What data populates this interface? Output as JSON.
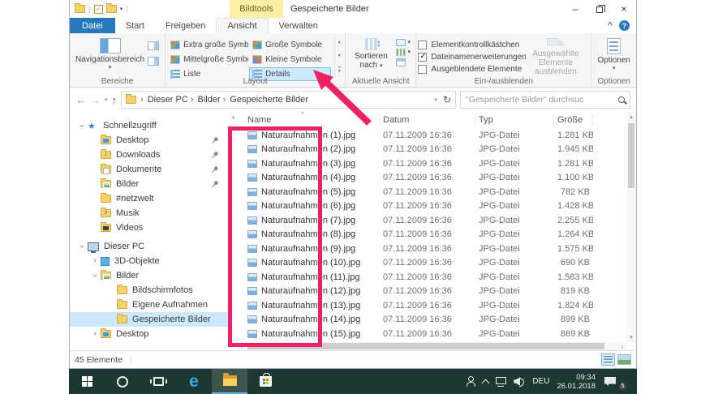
{
  "icons": {
    "minimize": "–",
    "close": "×",
    "dropdown": "▾",
    "help": "?",
    "collapse_ribbon": "^",
    "back": "←",
    "forward": "→",
    "up": "↑",
    "refresh": "↻",
    "crumb_sep": "›",
    "sort_asc": "^",
    "updown": "↕",
    "up_small": "▴",
    "down_small": "▾",
    "left_small": "‹",
    "right_small": "›",
    "separator": "|"
  },
  "window": {
    "title": "Gespeicherte Bilder",
    "contextual_tab": "Bildtools"
  },
  "tabs": [
    {
      "label": "Datei",
      "state": "file"
    },
    {
      "label": "Start",
      "state": ""
    },
    {
      "label": "Freigeben",
      "state": ""
    },
    {
      "label": "Ansicht",
      "state": "active"
    },
    {
      "label": "Verwalten",
      "state": ""
    }
  ],
  "ribbon": {
    "bereiche": {
      "label": "Bereiche",
      "nav_button": "Navigationsbereich"
    },
    "layout": {
      "label": "Layout",
      "options": [
        {
          "label": "Extra große Symbole",
          "icon": "ico-tiles",
          "state": ""
        },
        {
          "label": "Mittelgroße Symbole",
          "icon": "ico-tiles",
          "state": ""
        },
        {
          "label": "Liste",
          "icon": "ico-list",
          "state": ""
        },
        {
          "label": "Große Symbole",
          "icon": "ico-tiles",
          "state": ""
        },
        {
          "label": "Kleine Symbole",
          "icon": "ico-tiles2",
          "state": ""
        },
        {
          "label": "Details",
          "icon": "ico-list",
          "state": "selected"
        }
      ]
    },
    "aktuelle_ansicht": {
      "label": "Aktuelle Ansicht",
      "sort_label": "Sortieren nach"
    },
    "ein_ausblenden": {
      "label": "Ein-/ausblenden",
      "checkboxes": [
        {
          "label": "Elementkontrollkästchen",
          "state": ""
        },
        {
          "label": "Dateinamenerweiterungen",
          "state": "checked"
        },
        {
          "label": "Ausgeblendete Elemente",
          "state": ""
        }
      ],
      "hide_button": "Ausgewählte Elemente ausblenden"
    },
    "optionen": {
      "label": "Optionen"
    }
  },
  "address": {
    "crumbs": [
      {
        "t": "Dieser PC"
      },
      {
        "t": "Bilder"
      },
      {
        "t": "Gespeicherte Bilder"
      }
    ],
    "search_placeholder": "\"Gespeicherte Bilder\" durchsuc"
  },
  "sidebar": {
    "items": [
      {
        "label": "Schnellzugriff",
        "icon": "ic-star",
        "chev": "d",
        "state": "lvl0"
      },
      {
        "label": "Desktop",
        "icon": "ic-f ic-f-desktop",
        "chev": "",
        "state": "lvl1 pinned"
      },
      {
        "label": "Downloads",
        "icon": "ic-f ic-f-down",
        "chev": "",
        "state": "lvl1 pinned"
      },
      {
        "label": "Dokumente",
        "icon": "ic-f ic-f-doc",
        "chev": "",
        "state": "lvl1 pinned"
      },
      {
        "label": "Bilder",
        "icon": "ic-f ic-f-pic",
        "chev": "",
        "state": "lvl1 pinned"
      },
      {
        "label": "#netzwelt",
        "icon": "ic-f",
        "chev": "",
        "state": "lvl1"
      },
      {
        "label": "Musik",
        "icon": "ic-f ic-f-music",
        "chev": "",
        "state": "lvl1"
      },
      {
        "label": "Videos",
        "icon": "ic-f ic-f-video",
        "chev": "",
        "state": "lvl1"
      },
      {
        "label": "Dieser PC",
        "icon": "ic-pc",
        "chev": "d",
        "state": "lvl0 gap"
      },
      {
        "label": "3D-Objekte",
        "icon": "ic-3d",
        "chev": "r",
        "state": "lvl1c"
      },
      {
        "label": "Bilder",
        "icon": "ic-f ic-f-pic",
        "chev": "d",
        "state": "lvl1c"
      },
      {
        "label": "Bildschirmfotos",
        "icon": "ic-f",
        "chev": "",
        "state": "lvl2"
      },
      {
        "label": "Eigene Aufnahmen",
        "icon": "ic-f",
        "chev": "",
        "state": "lvl2"
      },
      {
        "label": "Gespeicherte Bilder",
        "icon": "ic-f",
        "chev": "",
        "state": "lvl2 selected"
      },
      {
        "label": "Desktop",
        "icon": "ic-f ic-f-desktop",
        "chev": "r",
        "state": "lvl1c"
      }
    ]
  },
  "file_list": {
    "columns": {
      "name": "Name",
      "date": "Datum",
      "type": "Typ",
      "size": "Größe"
    },
    "files": [
      {
        "name": "Naturaufnahmen (1).jpg",
        "date": "07.11.2009 16:36",
        "type": "JPG-Datei",
        "size": "1.281 KB"
      },
      {
        "name": "Naturaufnahmen (2).jpg",
        "date": "07.11.2009 16:36",
        "type": "JPG-Datei",
        "size": "1.945 KB"
      },
      {
        "name": "Naturaufnahmen (3).jpg",
        "date": "07.11.2009 16:36",
        "type": "JPG-Datei",
        "size": "1.281 KB"
      },
      {
        "name": "Naturaufnahmen (4).jpg",
        "date": "07.11.2009 16:36",
        "type": "JPG-Datei",
        "size": "1.100 KB"
      },
      {
        "name": "Naturaufnahmen (5).jpg",
        "date": "07.11.2009 16:36",
        "type": "JPG-Datei",
        "size": "782 KB"
      },
      {
        "name": "Naturaufnahmen (6).jpg",
        "date": "07.11.2009 16:36",
        "type": "JPG-Datei",
        "size": "1.428 KB"
      },
      {
        "name": "Naturaufnahmen (7).jpg",
        "date": "07.11.2009 16:36",
        "type": "JPG-Datei",
        "size": "2.255 KB"
      },
      {
        "name": "Naturaufnahmen (8).jpg",
        "date": "07.11.2009 16:36",
        "type": "JPG-Datei",
        "size": "1.264 KB"
      },
      {
        "name": "Naturaufnahmen (9).jpg",
        "date": "07.11.2009 16:36",
        "type": "JPG-Datei",
        "size": "1.575 KB"
      },
      {
        "name": "Naturaufnahmen (10).jpg",
        "date": "07.11.2009 16:36",
        "type": "JPG-Datei",
        "size": "690 KB"
      },
      {
        "name": "Naturaufnahmen (11).jpg",
        "date": "07.11.2009 16:36",
        "type": "JPG-Datei",
        "size": "1.583 KB"
      },
      {
        "name": "Naturaufnahmen (12).jpg",
        "date": "07.11.2009 16:36",
        "type": "JPG-Datei",
        "size": "819 KB"
      },
      {
        "name": "Naturaufnahmen (13).jpg",
        "date": "07.11.2009 16:36",
        "type": "JPG-Datei",
        "size": "1.824 KB"
      },
      {
        "name": "Naturaufnahmen (14).jpg",
        "date": "07.11.2009 16:36",
        "type": "JPG-Datei",
        "size": "899 KB"
      },
      {
        "name": "Naturaufnahmen (15).jpg",
        "date": "07.11.2009 16:36",
        "type": "JPG-Datei",
        "size": "869 KB"
      }
    ]
  },
  "status": {
    "count": "45 Elemente"
  },
  "taskbar": {
    "language": "DEU",
    "time": "09:34",
    "date": "26.01.2018",
    "notification_count": "5"
  },
  "colors": {
    "accent_blue": "#2878be",
    "annotation_pink": "#ed2265",
    "taskbar_bg": "#1b3832",
    "selection_blue": "#cce8ff",
    "contextual_tab_yellow": "#fdf0a6"
  }
}
